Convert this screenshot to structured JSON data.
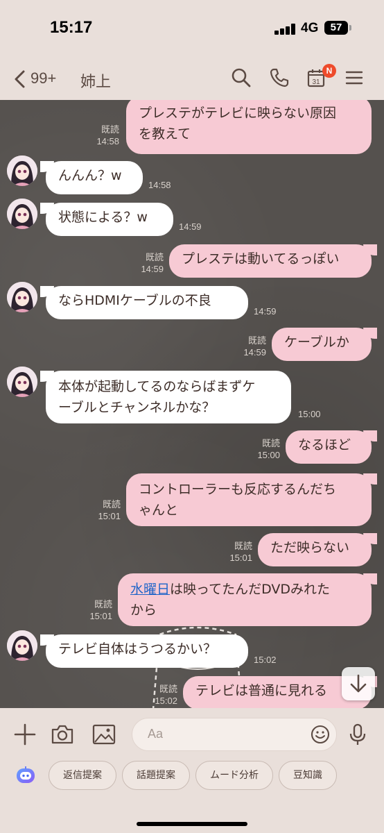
{
  "status": {
    "time": "15:17",
    "network": "4G",
    "battery": "57"
  },
  "header": {
    "back_count": "99+",
    "title": "姉上",
    "calendar_day": "31",
    "calendar_badge": "N"
  },
  "messages": [
    {
      "side": "mine",
      "text": "プレステがテレビに映らない原因\nを教えて",
      "read": "既読",
      "time": "14:58"
    },
    {
      "side": "theirs",
      "text": "んんん？w",
      "time": "14:58"
    },
    {
      "side": "theirs",
      "text": "状態による？w",
      "time": "14:59"
    },
    {
      "side": "mine",
      "text": "プレステは動いてるっぽい",
      "read": "既読",
      "time": "14:59"
    },
    {
      "side": "theirs",
      "text": "ならHDMIケーブルの不良",
      "time": "14:59"
    },
    {
      "side": "mine",
      "text": "ケーブルか",
      "read": "既読",
      "time": "14:59"
    },
    {
      "side": "theirs",
      "text": "本体が起動してるのならばまずケ\nーブルとチャンネルかな？",
      "time": "15:00"
    },
    {
      "side": "mine",
      "text": "なるほど",
      "read": "既読",
      "time": "15:00"
    },
    {
      "side": "mine",
      "text": "コントローラーも反応するんだち\nゃんと",
      "read": "既読",
      "time": "15:01"
    },
    {
      "side": "mine",
      "text": "ただ映らない",
      "read": "既読",
      "time": "15:01"
    },
    {
      "side": "mine",
      "link": "水曜日",
      "text": "は映ってたんだDVDみれた\nから",
      "read": "既読",
      "time": "15:01"
    },
    {
      "side": "theirs",
      "text": "テレビ自体はうつるかい？",
      "time": "15:02"
    },
    {
      "side": "mine",
      "text": "テレビは普通に見れる",
      "read": "既読",
      "time": "15:02"
    }
  ],
  "input": {
    "placeholder": "Aa"
  },
  "chips": [
    "返信提案",
    "話題提案",
    "ムード分析",
    "豆知識"
  ],
  "colors": {
    "my_bubble": "#f7cad4",
    "their_bubble": "#ffffff",
    "chat_bg": "#55514e",
    "bar_bg": "#e9dfda",
    "badge": "#ee4b2b"
  },
  "icons": [
    "back-chevron-icon",
    "search-icon",
    "phone-icon",
    "calendar-icon",
    "menu-icon",
    "scroll-down-icon",
    "plus-icon",
    "camera-icon",
    "image-icon",
    "emoji-icon",
    "mic-icon",
    "ai-assistant-icon"
  ]
}
